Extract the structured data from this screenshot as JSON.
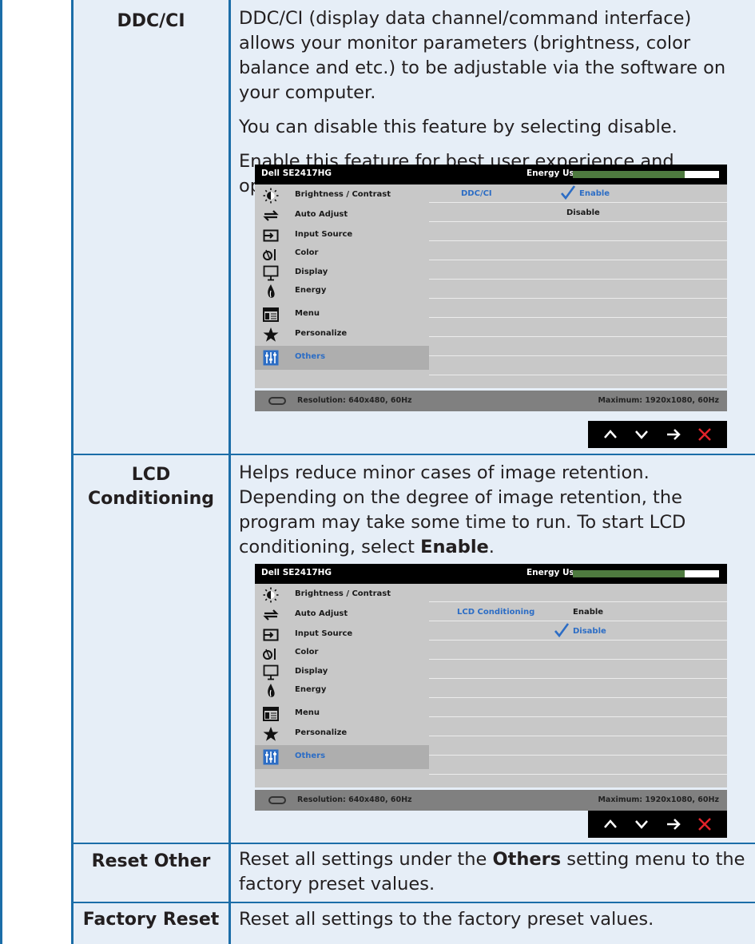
{
  "rows": {
    "ddcci": {
      "title": "DDC/CI",
      "p1": "DDC/CI (display data channel/command interface) allows your monitor parameters (brightness, color balance and etc.) to be adjustable via the software on your computer.",
      "p2": "You can disable this feature by selecting disable.",
      "p3": "Enable this feature for best user experience and optimum performance of your monitor."
    },
    "lcd": {
      "title_line1": "LCD",
      "title_line2": "Conditioning",
      "text_pre": "Helps reduce minor cases of image retention. Depending on the degree of image retention, the program may take some time to run. To start LCD conditioning, select ",
      "text_bold": "Enable",
      "text_post": "."
    },
    "reset_other": {
      "title": "Reset Other",
      "text_pre": "Reset all settings under the ",
      "text_bold": "Others",
      "text_post": " setting menu to the factory preset values."
    },
    "factory_reset": {
      "title": "Factory Reset",
      "text": "Reset all settings to the factory preset values."
    }
  },
  "osd": {
    "model": "Dell SE2417HG",
    "energy_use": "Energy Use",
    "menu": [
      {
        "label": "Brightness / Contrast",
        "icon": "brightness-icon"
      },
      {
        "label": "Auto Adjust",
        "icon": "auto-adjust-icon"
      },
      {
        "label": "Input Source",
        "icon": "input-source-icon"
      },
      {
        "label": "Color",
        "icon": "color-icon"
      },
      {
        "label": "Display",
        "icon": "display-icon"
      },
      {
        "label": "Energy",
        "icon": "energy-icon"
      },
      {
        "label": "Menu",
        "icon": "menu-icon"
      },
      {
        "label": "Personalize",
        "icon": "star-icon"
      },
      {
        "label": "Others",
        "icon": "others-icon"
      }
    ],
    "resolution": "Resolution: 640x480, 60Hz",
    "maximum": "Maximum: 1920x1080, 60Hz",
    "ddc": {
      "setting": "DDC/CI",
      "opt1": "Enable",
      "opt2": "Disable",
      "selected": "Enable"
    },
    "lcd": {
      "setting": "LCD Conditioning",
      "opt1": "Enable",
      "opt2": "Disable",
      "selected": "Disable"
    },
    "nav": [
      "up-icon",
      "down-icon",
      "enter-icon",
      "close-icon"
    ]
  },
  "colors": {
    "rule": "#1b6da8",
    "row_tint": "#e6eef7",
    "osd_grey": "#c8c8c8",
    "osd_select": "#2c6dc5",
    "energy_bar": "#4e7a3f",
    "nav_close": "#e1232a"
  }
}
